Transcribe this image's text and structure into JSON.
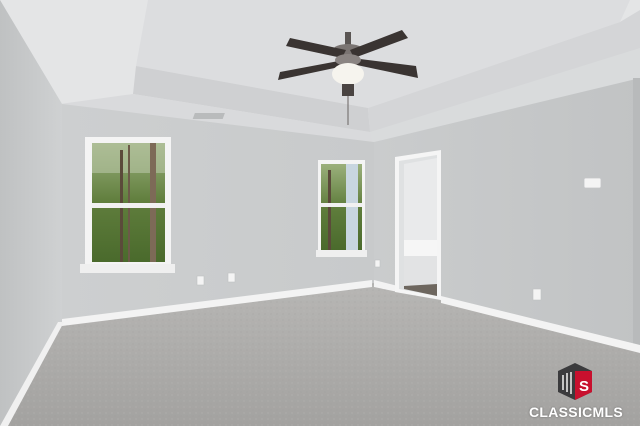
{
  "scene": {
    "kind": "empty bedroom photo",
    "elements": [
      "tray-ceiling",
      "ceiling-fan",
      "ceiling-vent",
      "left-window",
      "center-window",
      "bathroom-doorway",
      "thermostat",
      "outlets",
      "baseboards",
      "carpet"
    ]
  },
  "watermark": {
    "text": "CLASSICMLS",
    "logo_colors": {
      "dark": "#3b3b3d",
      "red": "#c8102e"
    }
  },
  "colors": {
    "wall": "#c9cbcc",
    "wall_shadow": "#b9bbbd",
    "ceiling": "#dedfe0",
    "carpet": "#a9a8a6",
    "trim": "#f2f2f2",
    "fan_blade": "#3a3432"
  }
}
